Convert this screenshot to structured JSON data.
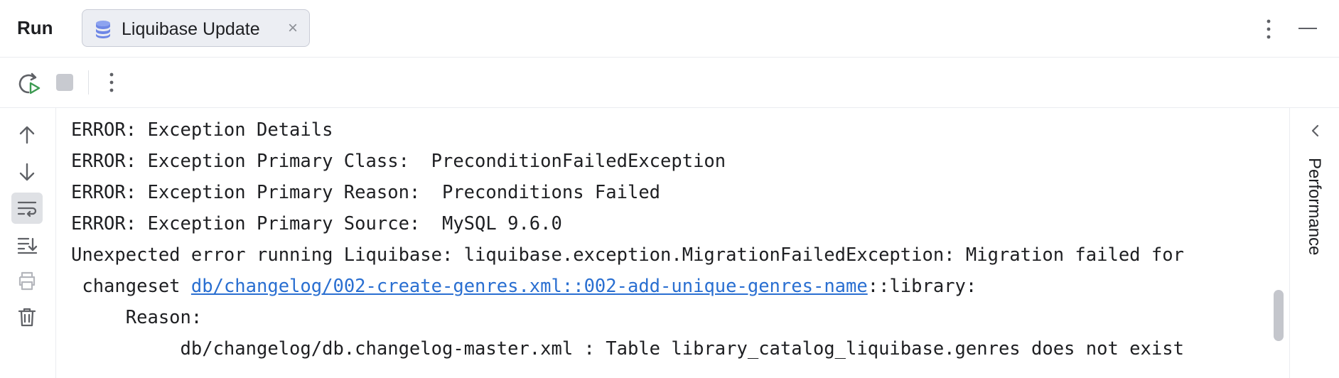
{
  "header": {
    "title": "Run",
    "tab": {
      "label": "Liquibase Update",
      "close_glyph": "×",
      "icon": "database-stack-icon"
    }
  },
  "toolbar": {
    "buttons": [
      "rerun-icon",
      "stop-icon",
      "more-vertical-icon"
    ]
  },
  "left_toolbar": {
    "buttons": [
      "arrow-up-icon",
      "arrow-down-icon",
      "soft-wrap-icon",
      "scroll-to-end-icon",
      "print-icon",
      "trash-icon"
    ],
    "active": "soft-wrap-icon"
  },
  "console": {
    "lines": [
      "ERROR: Exception Details",
      "ERROR: Exception Primary Class:  PreconditionFailedException",
      "ERROR: Exception Primary Reason:  Preconditions Failed",
      "ERROR: Exception Primary Source:  MySQL 9.6.0",
      "Unexpected error running Liquibase: liquibase.exception.MigrationFailedException: Migration failed for"
    ],
    "changeset_prefix": " changeset ",
    "changeset_link": "db/changelog/002-create-genres.xml::002-add-unique-genres-name",
    "changeset_suffix": "::library:",
    "reason_label": "     Reason:",
    "reason_detail": "          db/changelog/db.changelog-master.xml : Table library_catalog_liquibase.genres does not exist"
  },
  "right_panel": {
    "label": "Performance",
    "icon": "chevron-left-icon"
  },
  "colors": {
    "link": "#2a6fd1",
    "tab_bg": "#eceef3",
    "run_green": "#3d9a52"
  }
}
